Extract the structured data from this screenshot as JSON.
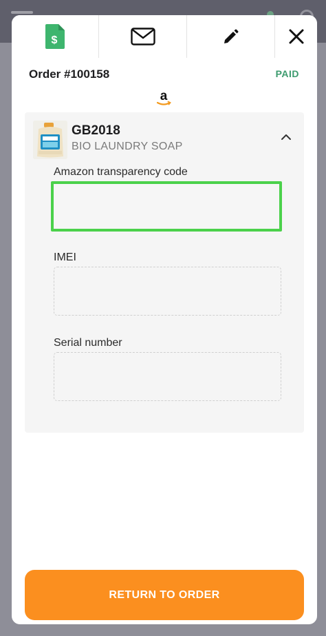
{
  "toolbar": {
    "invoice_icon": "invoice-dollar-icon",
    "email_icon": "envelope-icon",
    "edit_icon": "pencil-icon",
    "close_icon": "close-icon"
  },
  "order": {
    "number": "Order #100158",
    "status": "PAID",
    "marketplace_icon": "amazon-icon"
  },
  "item": {
    "sku": "GB2018",
    "name": "BIO LAUNDRY SOAP",
    "fields": [
      {
        "label": "Amazon transparency code",
        "value": ""
      },
      {
        "label": "IMEI",
        "value": ""
      },
      {
        "label": "Serial number",
        "value": ""
      }
    ]
  },
  "footer": {
    "return_label": "RETURN TO ORDER"
  },
  "colors": {
    "accent": "#fb8f1f",
    "paid": "#3c9b6e",
    "focus": "#4bd14b",
    "invoice_green": "#3eb56e"
  }
}
